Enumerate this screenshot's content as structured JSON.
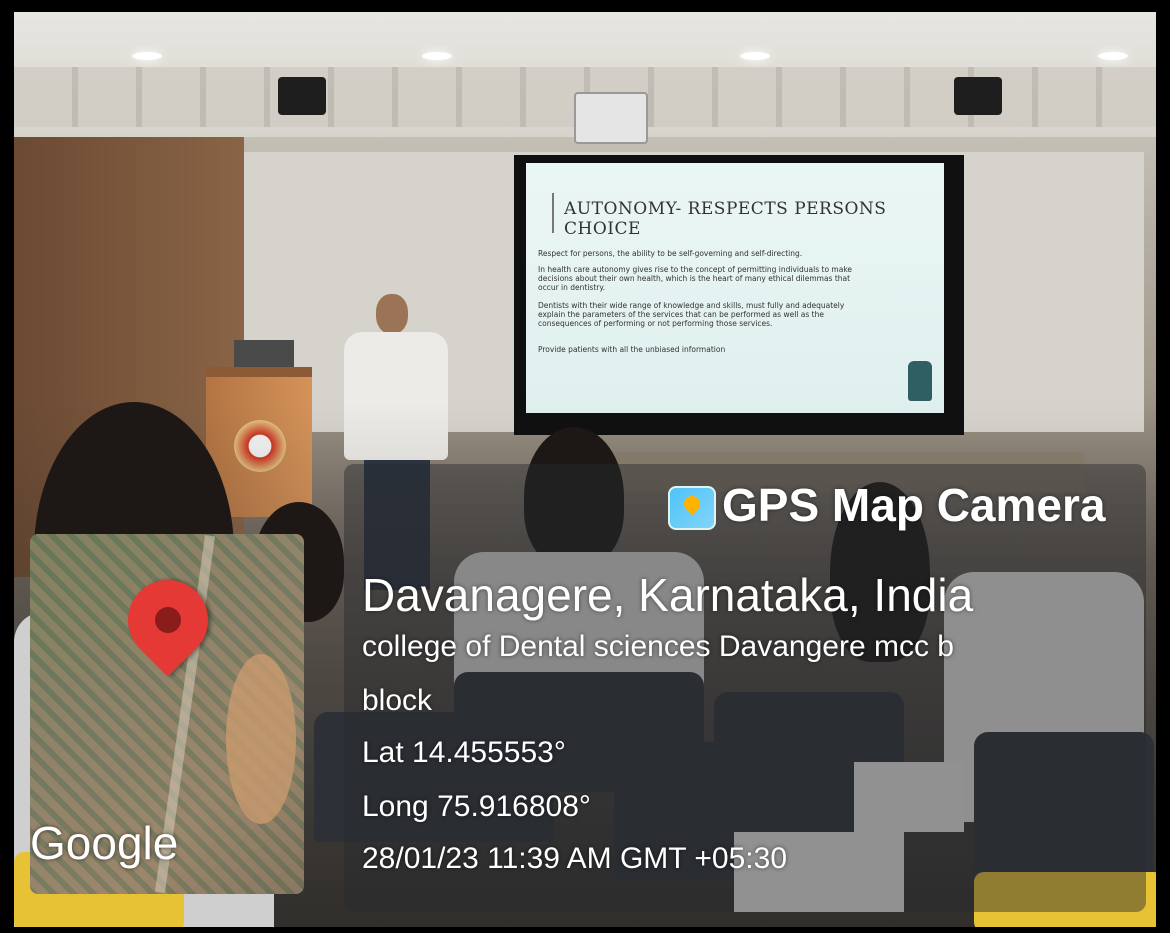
{
  "slide": {
    "title": "AUTONOMY- RESPECTS PERSONS CHOICE",
    "paragraphs": [
      "Respect for persons, the ability to be self-governing and self-directing.",
      "In health care autonomy gives rise to the concept of permitting individuals to make decisions about their own health, which is the heart of many ethical dilemmas that occur in dentistry.",
      "Dentists with their wide range of knowledge and skills, must fully and adequately explain the parameters of the services that can be performed as well as the consequences of performing or not performing those services.",
      "Provide patients with all the unbiased information"
    ],
    "icon": "raised-fist-icon"
  },
  "overlay": {
    "app_name": "GPS Map Camera",
    "app_icon": "map-pin-icon",
    "location_title": "Davanagere, Karnataka, India",
    "address_line1": "college of Dental sciences Davangere mcc b",
    "address_line2": "block",
    "latitude": "Lat 14.455553°",
    "longitude": "Long 75.916808°",
    "datetime": "28/01/23 11:39 AM GMT +05:30",
    "map_brand": "Google",
    "map_pin_icon": "location-pin-icon"
  },
  "colors": {
    "pin": "#e53935",
    "overlay_text": "#ffffff",
    "slide_bg": "#eaf6f4"
  }
}
